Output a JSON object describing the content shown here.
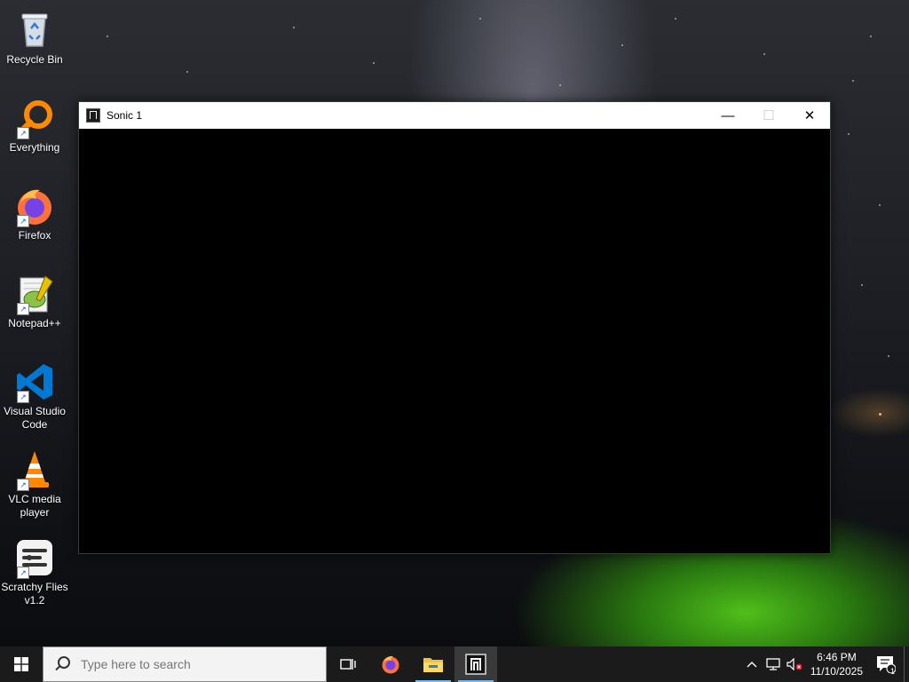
{
  "desktop": {
    "icons": [
      {
        "label": "Recycle Bin",
        "icon": "recycle-bin-icon"
      },
      {
        "label": "Everything",
        "icon": "everything-search-icon"
      },
      {
        "label": "Firefox",
        "icon": "firefox-icon"
      },
      {
        "label": "Notepad++",
        "icon": "notepadpp-icon"
      },
      {
        "label": "Visual Studio Code",
        "icon": "vscode-icon"
      },
      {
        "label": "VLC media player",
        "icon": "vlc-icon"
      },
      {
        "label": "Scratchy Flies v1.2",
        "icon": "scratchy-flies-icon"
      }
    ]
  },
  "window": {
    "title": "Sonic 1",
    "minimize_glyph": "—",
    "maximize_glyph": "☐",
    "close_glyph": "✕"
  },
  "taskbar": {
    "search_placeholder": "Type here to search",
    "clock_time": "6:46 PM",
    "clock_date": "11/10/2025",
    "notification_count": "1"
  },
  "colors": {
    "taskbar": "#1b1b1b",
    "accent": "#76b9ed",
    "vscode_blue": "#0078d4",
    "firefox_orange": "#ff7139",
    "everything_orange": "#ff8a00"
  }
}
